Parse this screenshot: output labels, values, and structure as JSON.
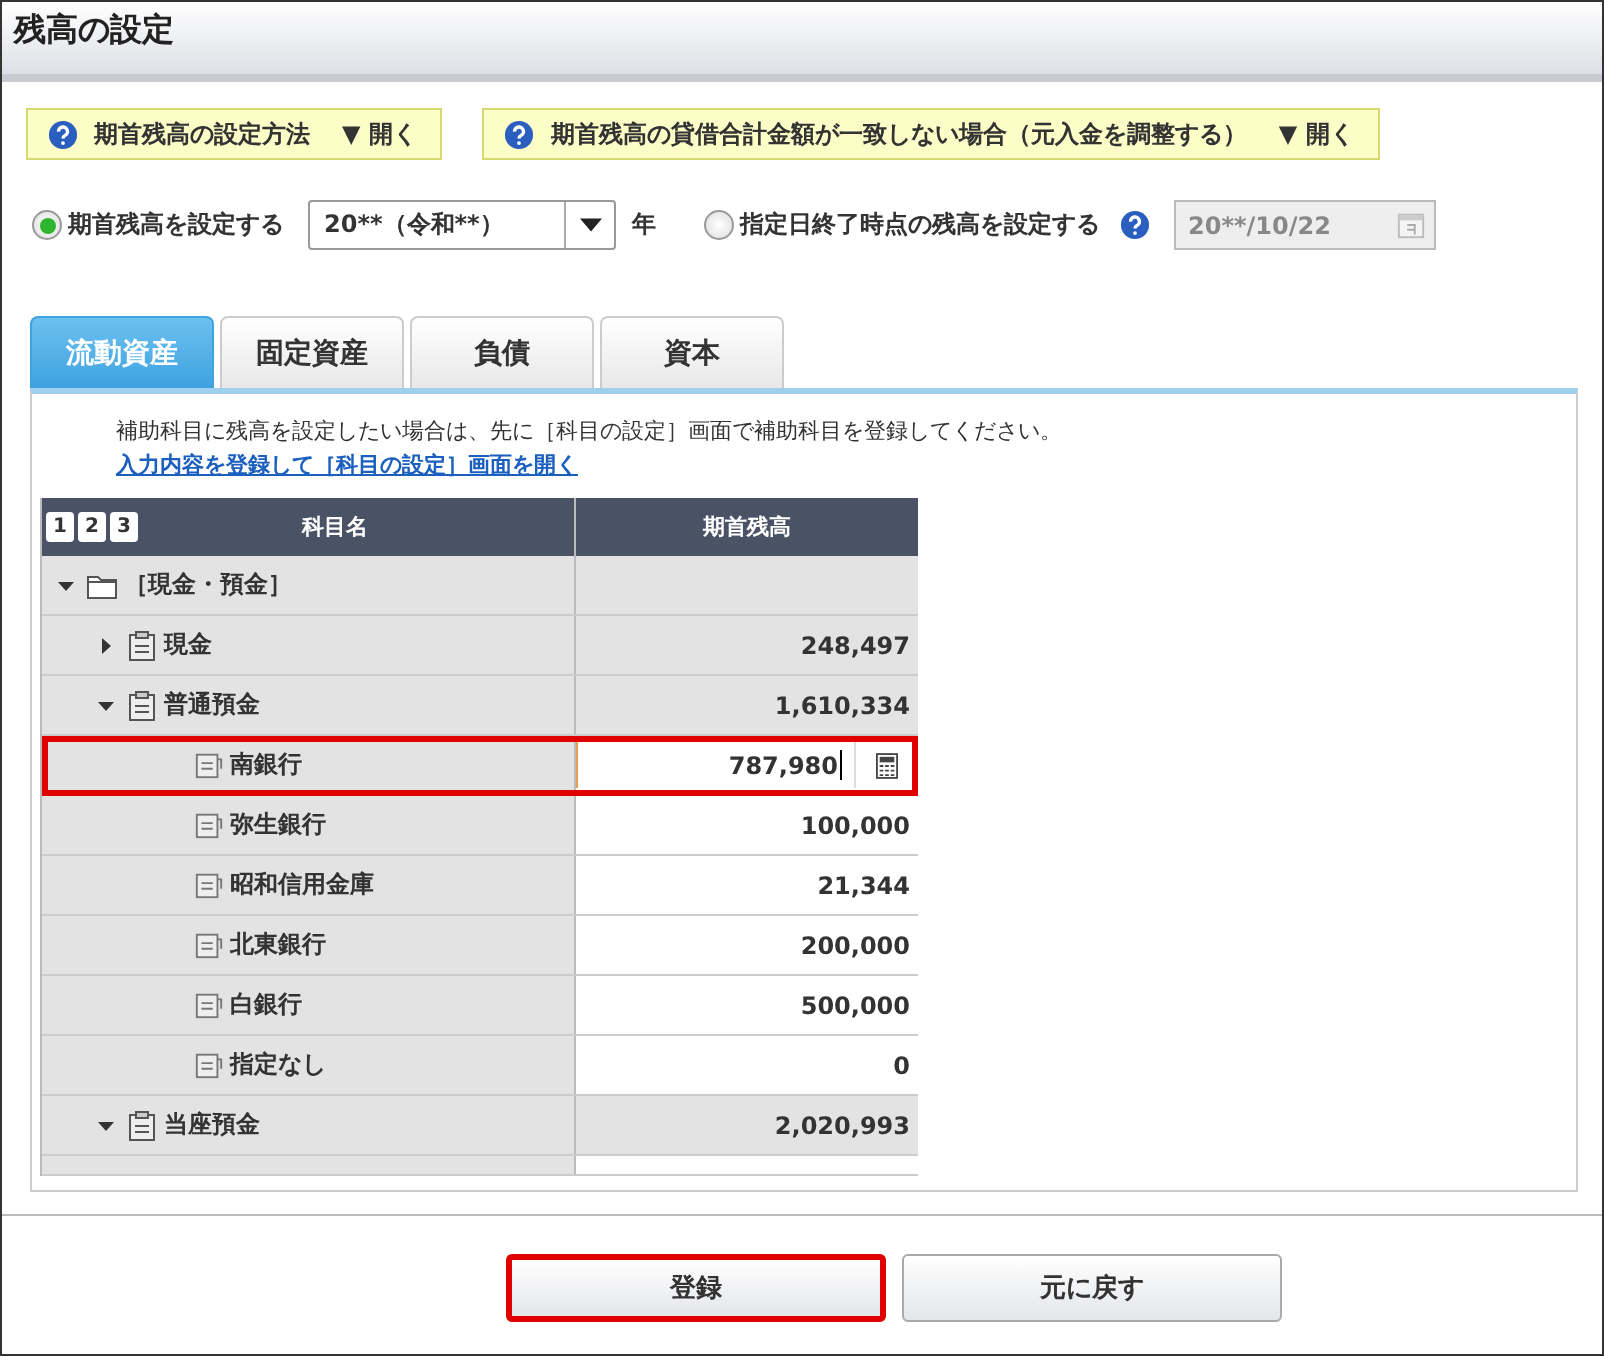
{
  "window": {
    "title": "残高の設定"
  },
  "help_bars": [
    {
      "label": "期首残高の設定方法",
      "toggle": "▼ 開く"
    },
    {
      "label": "期首残高の貸借合計金額が一致しない場合（元入金を調整する）",
      "toggle": "▼ 開く"
    }
  ],
  "mode": {
    "options": [
      {
        "label": "期首残高を設定する",
        "selected": true
      },
      {
        "label": "指定日終了時点の残高を設定する",
        "selected": false
      }
    ],
    "year_select": {
      "value": "20**（令和**）",
      "unit": "年"
    },
    "date_field": {
      "value": "20**/10/22",
      "disabled": true
    }
  },
  "tabs": [
    {
      "label": "流動資産",
      "selected": true
    },
    {
      "label": "固定資産",
      "selected": false
    },
    {
      "label": "負債",
      "selected": false
    },
    {
      "label": "資本",
      "selected": false
    }
  ],
  "notice": {
    "text": "補助科目に残高を設定したい場合は、先に［科目の設定］画面で補助科目を登録してください。",
    "link": "入力内容を登録して［科目の設定］画面を開く"
  },
  "table": {
    "levels": [
      "1",
      "2",
      "3"
    ],
    "columns": [
      "科目名",
      "期首残高"
    ],
    "rows": [
      {
        "kind": "folder",
        "name": "［現金・預金］",
        "expanded": true,
        "children": [
          {
            "kind": "account",
            "name": "現金",
            "value": "248,497",
            "expanded": false
          },
          {
            "kind": "account",
            "name": "普通預金",
            "value": "1,610,334",
            "expanded": true,
            "children": [
              {
                "kind": "subaccount",
                "name": "南銀行",
                "value": "787,980",
                "editing": true,
                "highlighted": true
              },
              {
                "kind": "subaccount",
                "name": "弥生銀行",
                "value": "100,000",
                "editing": false,
                "highlighted": false
              },
              {
                "kind": "subaccount",
                "name": "昭和信用金庫",
                "value": "21,344",
                "editing": false,
                "highlighted": false
              },
              {
                "kind": "subaccount",
                "name": "北東銀行",
                "value": "200,000",
                "editing": false,
                "highlighted": false
              },
              {
                "kind": "subaccount",
                "name": "白銀行",
                "value": "500,000",
                "editing": false,
                "highlighted": false
              },
              {
                "kind": "subaccount",
                "name": "指定なし",
                "value": "0",
                "editing": false,
                "highlighted": false
              }
            ]
          },
          {
            "kind": "account",
            "name": "当座預金",
            "value": "2,020,993",
            "expanded": true
          }
        ]
      }
    ]
  },
  "buttons": [
    {
      "label": "登録",
      "highlighted": true
    },
    {
      "label": "元に戻す",
      "highlighted": false
    }
  ]
}
